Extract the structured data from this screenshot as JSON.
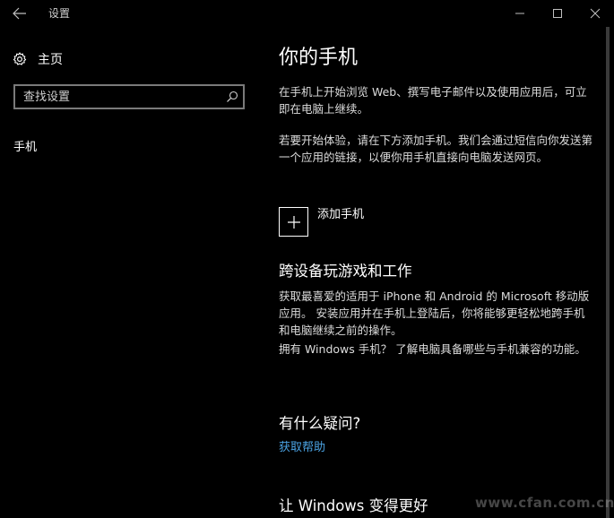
{
  "window": {
    "title": "设置"
  },
  "sidebar": {
    "home_label": "主页",
    "search_placeholder": "查找设置",
    "items": [
      {
        "label": "手机"
      }
    ]
  },
  "main": {
    "title": "你的手机",
    "intro": "在手机上开始浏览 Web、撰写电子邮件以及使用应用后，可立即在电脑上继续。",
    "instructions": "若要开始体验，请在下方添加手机。我们会通过短信向你发送第一个应用的链接，以便你用手机直接向电脑发送网页。",
    "add_phone_label": "添加手机",
    "cross_device": {
      "title": "跨设备玩游戏和工作",
      "body": "获取最喜爱的适用于 iPhone 和 Android 的 Microsoft 移动版应用。 安装应用并在手机上登陆后，你将能够更轻松地跨手机和电脑继续之前的操作。",
      "windows_phone": "拥有 Windows 手机？ 了解电脑具备哪些与手机兼容的功能。"
    },
    "questions": {
      "title": "有什么疑问?",
      "help_link": "获取帮助"
    },
    "improve": {
      "title": "让 Windows 变得更好"
    }
  },
  "watermark": {
    "text": "www.cfan.com.cn"
  },
  "colors": {
    "background": "#000000",
    "text": "#ffffff",
    "secondary_text": "#dcdcdc",
    "link": "#4ba3e3",
    "search_border": "#7a7a7a"
  }
}
